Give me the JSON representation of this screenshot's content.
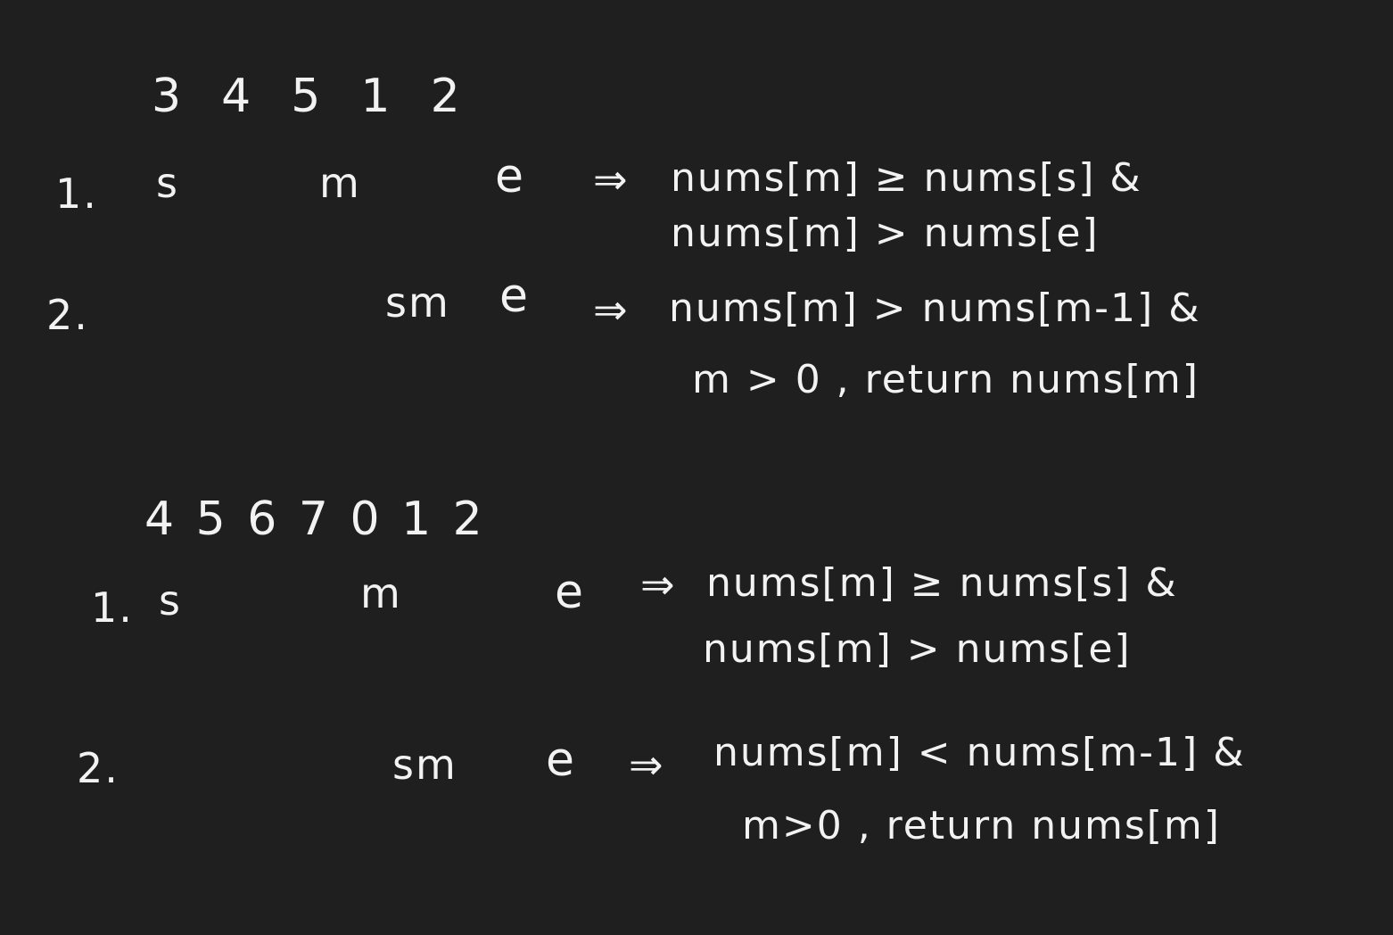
{
  "notes": {
    "section1": {
      "array": "3  4  5  1  2",
      "step1": {
        "label": "1.",
        "pointers_s": "s",
        "pointers_m": "m",
        "pointers_e": "e",
        "arrow": "⇒",
        "line1": "nums[m] ≥ nums[s] &",
        "line2": "nums[m] > nums[e]"
      },
      "step2": {
        "label": "2.",
        "pointers_sm": "sm",
        "pointers_e": "e",
        "arrow": "⇒",
        "line1": "nums[m] > nums[m-1] &",
        "line2": "m > 0 , return nums[m]"
      }
    },
    "section2": {
      "array": "4 5 6 7 0 1 2",
      "step1": {
        "label": "1.",
        "pointers_s": "s",
        "pointers_m": "m",
        "pointers_e": "e",
        "arrow": "⇒",
        "line1": "nums[m] ≥ nums[s] &",
        "line2": "nums[m] > nums[e]"
      },
      "step2": {
        "label": "2.",
        "pointers_sm": "sm",
        "pointers_e": "e",
        "arrow": "⇒",
        "line1": "nums[m] < nums[m-1] &",
        "line2": "m>0 , return nums[m]"
      }
    }
  }
}
